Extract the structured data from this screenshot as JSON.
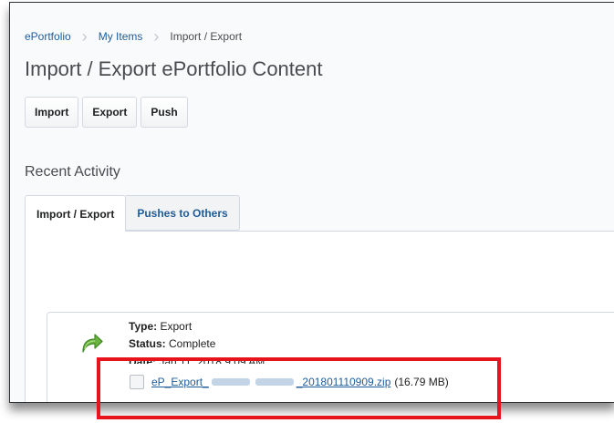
{
  "breadcrumb": {
    "items": [
      "ePortfolio",
      "My Items"
    ],
    "current": "Import / Export"
  },
  "page_title": "Import / Export ePortfolio Content",
  "toolbar": {
    "import_label": "Import",
    "export_label": "Export",
    "push_label": "Push"
  },
  "recent_activity": {
    "heading": "Recent Activity",
    "tabs": [
      {
        "label": "Import / Export",
        "active": true
      },
      {
        "label": "Pushes to Others",
        "active": false
      }
    ]
  },
  "activity_item": {
    "type_label": "Type:",
    "type_value": "Export",
    "status_label": "Status:",
    "status_value": "Complete",
    "date_label": "Date:",
    "date_value": "Jan 11, 2018 9:09 AM",
    "file_prefix": "eP_Export_",
    "file_suffix": "_201801110909.zip",
    "file_size": "(16.79 MB)"
  },
  "colors": {
    "link": "#1f5c99",
    "highlight": "#e8141b",
    "arrow_icon": "#6cb33f"
  }
}
